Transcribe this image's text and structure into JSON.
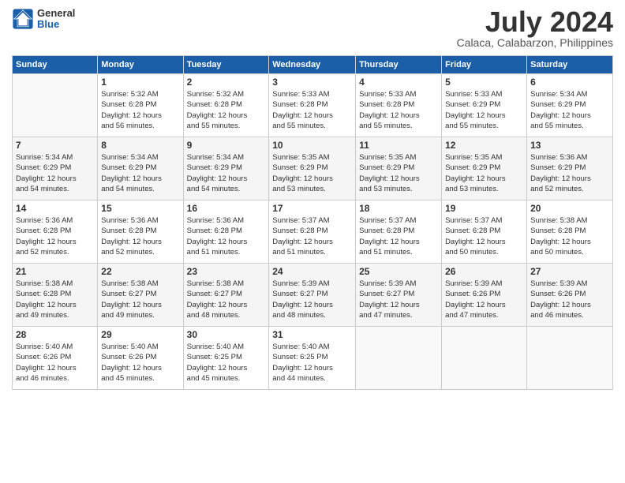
{
  "header": {
    "logo_general": "General",
    "logo_blue": "Blue",
    "month": "July 2024",
    "location": "Calaca, Calabarzon, Philippines"
  },
  "days_of_week": [
    "Sunday",
    "Monday",
    "Tuesday",
    "Wednesday",
    "Thursday",
    "Friday",
    "Saturday"
  ],
  "weeks": [
    [
      {
        "day": "",
        "info": ""
      },
      {
        "day": "1",
        "info": "Sunrise: 5:32 AM\nSunset: 6:28 PM\nDaylight: 12 hours\nand 56 minutes."
      },
      {
        "day": "2",
        "info": "Sunrise: 5:32 AM\nSunset: 6:28 PM\nDaylight: 12 hours\nand 55 minutes."
      },
      {
        "day": "3",
        "info": "Sunrise: 5:33 AM\nSunset: 6:28 PM\nDaylight: 12 hours\nand 55 minutes."
      },
      {
        "day": "4",
        "info": "Sunrise: 5:33 AM\nSunset: 6:28 PM\nDaylight: 12 hours\nand 55 minutes."
      },
      {
        "day": "5",
        "info": "Sunrise: 5:33 AM\nSunset: 6:29 PM\nDaylight: 12 hours\nand 55 minutes."
      },
      {
        "day": "6",
        "info": "Sunrise: 5:34 AM\nSunset: 6:29 PM\nDaylight: 12 hours\nand 55 minutes."
      }
    ],
    [
      {
        "day": "7",
        "info": "Sunrise: 5:34 AM\nSunset: 6:29 PM\nDaylight: 12 hours\nand 54 minutes."
      },
      {
        "day": "8",
        "info": "Sunrise: 5:34 AM\nSunset: 6:29 PM\nDaylight: 12 hours\nand 54 minutes."
      },
      {
        "day": "9",
        "info": "Sunrise: 5:34 AM\nSunset: 6:29 PM\nDaylight: 12 hours\nand 54 minutes."
      },
      {
        "day": "10",
        "info": "Sunrise: 5:35 AM\nSunset: 6:29 PM\nDaylight: 12 hours\nand 53 minutes."
      },
      {
        "day": "11",
        "info": "Sunrise: 5:35 AM\nSunset: 6:29 PM\nDaylight: 12 hours\nand 53 minutes."
      },
      {
        "day": "12",
        "info": "Sunrise: 5:35 AM\nSunset: 6:29 PM\nDaylight: 12 hours\nand 53 minutes."
      },
      {
        "day": "13",
        "info": "Sunrise: 5:36 AM\nSunset: 6:29 PM\nDaylight: 12 hours\nand 52 minutes."
      }
    ],
    [
      {
        "day": "14",
        "info": "Sunrise: 5:36 AM\nSunset: 6:28 PM\nDaylight: 12 hours\nand 52 minutes."
      },
      {
        "day": "15",
        "info": "Sunrise: 5:36 AM\nSunset: 6:28 PM\nDaylight: 12 hours\nand 52 minutes."
      },
      {
        "day": "16",
        "info": "Sunrise: 5:36 AM\nSunset: 6:28 PM\nDaylight: 12 hours\nand 51 minutes."
      },
      {
        "day": "17",
        "info": "Sunrise: 5:37 AM\nSunset: 6:28 PM\nDaylight: 12 hours\nand 51 minutes."
      },
      {
        "day": "18",
        "info": "Sunrise: 5:37 AM\nSunset: 6:28 PM\nDaylight: 12 hours\nand 51 minutes."
      },
      {
        "day": "19",
        "info": "Sunrise: 5:37 AM\nSunset: 6:28 PM\nDaylight: 12 hours\nand 50 minutes."
      },
      {
        "day": "20",
        "info": "Sunrise: 5:38 AM\nSunset: 6:28 PM\nDaylight: 12 hours\nand 50 minutes."
      }
    ],
    [
      {
        "day": "21",
        "info": "Sunrise: 5:38 AM\nSunset: 6:28 PM\nDaylight: 12 hours\nand 49 minutes."
      },
      {
        "day": "22",
        "info": "Sunrise: 5:38 AM\nSunset: 6:27 PM\nDaylight: 12 hours\nand 49 minutes."
      },
      {
        "day": "23",
        "info": "Sunrise: 5:38 AM\nSunset: 6:27 PM\nDaylight: 12 hours\nand 48 minutes."
      },
      {
        "day": "24",
        "info": "Sunrise: 5:39 AM\nSunset: 6:27 PM\nDaylight: 12 hours\nand 48 minutes."
      },
      {
        "day": "25",
        "info": "Sunrise: 5:39 AM\nSunset: 6:27 PM\nDaylight: 12 hours\nand 47 minutes."
      },
      {
        "day": "26",
        "info": "Sunrise: 5:39 AM\nSunset: 6:26 PM\nDaylight: 12 hours\nand 47 minutes."
      },
      {
        "day": "27",
        "info": "Sunrise: 5:39 AM\nSunset: 6:26 PM\nDaylight: 12 hours\nand 46 minutes."
      }
    ],
    [
      {
        "day": "28",
        "info": "Sunrise: 5:40 AM\nSunset: 6:26 PM\nDaylight: 12 hours\nand 46 minutes."
      },
      {
        "day": "29",
        "info": "Sunrise: 5:40 AM\nSunset: 6:26 PM\nDaylight: 12 hours\nand 45 minutes."
      },
      {
        "day": "30",
        "info": "Sunrise: 5:40 AM\nSunset: 6:25 PM\nDaylight: 12 hours\nand 45 minutes."
      },
      {
        "day": "31",
        "info": "Sunrise: 5:40 AM\nSunset: 6:25 PM\nDaylight: 12 hours\nand 44 minutes."
      },
      {
        "day": "",
        "info": ""
      },
      {
        "day": "",
        "info": ""
      },
      {
        "day": "",
        "info": ""
      }
    ]
  ]
}
